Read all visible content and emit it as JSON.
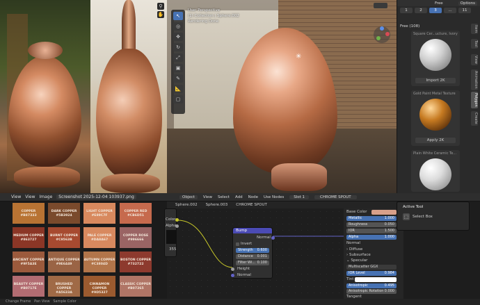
{
  "colors": {
    "accent": "#4772b3",
    "copper": "#b87333"
  },
  "photo_tools": [
    {
      "name": "zoom-icon",
      "glyph": "⚲"
    },
    {
      "name": "hand-icon",
      "glyph": "✋"
    }
  ],
  "viewport": {
    "info": [
      "User Perspective",
      "(1) Collection | Sphere.002",
      "Rendering Done"
    ],
    "options_label": "Options"
  },
  "viewport_tools": [
    {
      "name": "select-box-tool",
      "glyph": "↖",
      "active": true
    },
    {
      "name": "cursor-tool",
      "glyph": "◎"
    },
    {
      "name": "move-tool",
      "glyph": "✥"
    },
    {
      "name": "rotate-tool",
      "glyph": "↻"
    },
    {
      "name": "scale-tool",
      "glyph": "⤢"
    },
    {
      "name": "transform-tool",
      "glyph": "▣"
    },
    {
      "name": "annotate-tool",
      "glyph": "✎"
    },
    {
      "name": "measure-tool",
      "glyph": "📐"
    },
    {
      "name": "add-cube-tool",
      "glyph": "▢"
    }
  ],
  "asset_panel": {
    "title": "Free",
    "tabs": [
      "1",
      "2",
      "3",
      "...",
      "11"
    ],
    "active_tab": 2,
    "count_label": "Free (108)",
    "cards": [
      {
        "name": "Square Cer...ucture, Ivory",
        "button": "Import 2K"
      },
      {
        "name": "Gold Paint Metal Texture",
        "button": "Apply 2K"
      },
      {
        "name": "Plain White Ceramic Te...",
        "button": ""
      }
    ],
    "side_tabs": [
      "Item",
      "Tool",
      "View",
      "Animation",
      "Polygon",
      "Create"
    ]
  },
  "image_editor": {
    "menu": [
      "View",
      "View",
      "Image"
    ],
    "filename": "Screenshot 2025-12-04 103937.png"
  },
  "swatches": [
    {
      "name": "COPPER",
      "hex": "#B87333",
      "bg": "#b87333"
    },
    {
      "name": "DARK COPPER",
      "hex": "#5B3924",
      "bg": "#7a4a2c"
    },
    {
      "name": "LIGHT COPPER",
      "hex": "#E89C7F",
      "bg": "#d8895e"
    },
    {
      "name": "COPPER RED",
      "hex": "#CB6D51",
      "bg": "#c66a4d"
    },
    {
      "name": "MEDIUM COPPER",
      "hex": "#863727",
      "bg": "#8b3626"
    },
    {
      "name": "BURNT COPPER",
      "hex": "#C9563B",
      "bg": "#a74a30"
    },
    {
      "name": "PALE COPPER",
      "hex": "#DA8A67",
      "bg": "#d8895f"
    },
    {
      "name": "COPPER ROSE",
      "hex": "#996666",
      "bg": "#9a6464"
    },
    {
      "name": "ANCIENT COPPER",
      "hex": "#9F5A3E",
      "bg": "#9b5a3c"
    },
    {
      "name": "ANTIQUE COPPER",
      "hex": "#9E6449",
      "bg": "#9a6445"
    },
    {
      "name": "AUTUMN COPPER",
      "hex": "#C3804D",
      "bg": "#b2754a"
    },
    {
      "name": "BOSTON COPPER",
      "hex": "#732722",
      "bg": "#8d3a2e"
    },
    {
      "name": "BEAUTY COPPER",
      "hex": "#B0717E",
      "bg": "#b26c72"
    },
    {
      "name": "BRUSHED COPPER",
      "hex": "#A5633A",
      "bg": "#a06a46"
    },
    {
      "name": "CINNAMON COPPER",
      "hex": "#9D5327",
      "bg": "#9b5a2f"
    },
    {
      "name": "CLASSIC COPPER",
      "hex": "#B07265",
      "bg": "#b07566"
    }
  ],
  "node_editor": {
    "header": [
      "Object",
      "View",
      "Select",
      "Add",
      "Node",
      "Use Nodes",
      "Slot 1",
      "CHROME SPOUT"
    ],
    "breadcrumb": [
      "Sphere.002",
      "Sphere.003",
      "CHROME SPOUT"
    ],
    "left_node": {
      "labels": [
        "Color",
        "Alpha"
      ],
      "value": "355"
    },
    "bump_node": {
      "title": "Bump",
      "output": "Normal",
      "invert": "Invert",
      "fields": [
        {
          "label": "Strength",
          "value": "0.600"
        },
        {
          "label": "Distance",
          "value": "0.001"
        },
        {
          "label": "Filter Wi...",
          "value": "0.100"
        }
      ],
      "inputs": [
        "Height",
        "Normal"
      ]
    }
  },
  "material": {
    "rows": [
      {
        "label": "Base Color",
        "value": ""
      },
      {
        "label": "Metallic",
        "value": "1.000"
      },
      {
        "label": "Roughness",
        "value": "0.050"
      },
      {
        "label": "IOR",
        "value": "1.500"
      },
      {
        "label": "Alpha",
        "value": "1.000"
      }
    ],
    "sections": [
      "Normal",
      "Diffuse",
      "Subsurface",
      "Specular"
    ],
    "dropdown": "Multiscatter GGX",
    "spec_rows": [
      {
        "label": "IOR Level",
        "value": "0.984"
      },
      {
        "label": "Tint",
        "value": ""
      },
      {
        "label": "Anisotropic",
        "value": "0.495"
      },
      {
        "label": "Anisotropic Rotation",
        "value": "0.000"
      }
    ],
    "tangent": "Tangent"
  },
  "tool_popup": {
    "title": "Active Tool",
    "item": "Select Box"
  },
  "status_bar": [
    "Change Frame",
    "Pan View",
    "Sample Color"
  ]
}
